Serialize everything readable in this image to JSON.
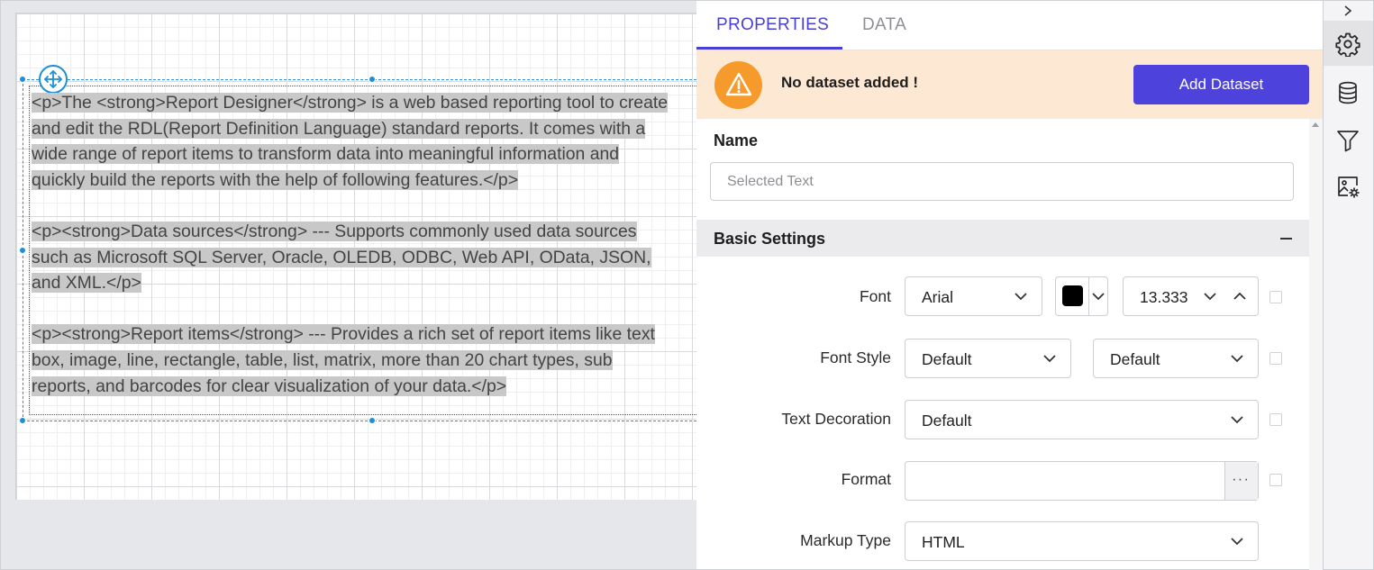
{
  "canvas": {
    "paragraphs": [
      [
        "<p>The <strong>Report Designer</strong> is a web based reporting tool to create",
        "and edit the RDL(Report Definition Language) standard reports. It comes with a",
        "wide range of report items to transform data into meaningful information and",
        "quickly build the reports with the help of following features.</p>"
      ],
      [
        "<p><strong>Data sources</strong> --- Supports commonly used data sources",
        "such as Microsoft SQL Server, Oracle, OLEDB, ODBC, Web API, OData, JSON,",
        "and XML.</p>"
      ],
      [
        "<p><strong>Report items</strong> --- Provides a rich set of report items like text",
        "box, image, line, rectangle, table, list, matrix, more than 20 chart types, sub",
        "reports, and barcodes for clear visualization of your data.</p>"
      ]
    ]
  },
  "panel": {
    "tabs": {
      "properties": "PROPERTIES",
      "data": "DATA"
    },
    "notice": {
      "text": "No dataset added !",
      "button": "Add Dataset",
      "icon": "warning-icon"
    },
    "name": {
      "label": "Name",
      "placeholder": "Selected Text",
      "value": ""
    },
    "basic_settings": {
      "title": "Basic Settings",
      "font_label": "Font",
      "font_family": "Arial",
      "font_color": "#000000",
      "font_size": "13.333",
      "font_style_label": "Font Style",
      "font_style": "Default",
      "font_weight": "Default",
      "text_decoration_label": "Text Decoration",
      "text_decoration": "Default",
      "format_label": "Format",
      "format_value": "",
      "format_button": "···",
      "markup_type_label": "Markup Type",
      "markup_type": "HTML"
    }
  },
  "right_bar": {
    "items": [
      "gear-icon",
      "database-icon",
      "filter-icon",
      "image-settings-icon"
    ]
  },
  "colors": {
    "accent": "#4a3fd4",
    "button": "#4e42dc",
    "notice_bg": "#fde9d3",
    "warning": "#f59a2b",
    "selection": "#1d8fd8"
  }
}
